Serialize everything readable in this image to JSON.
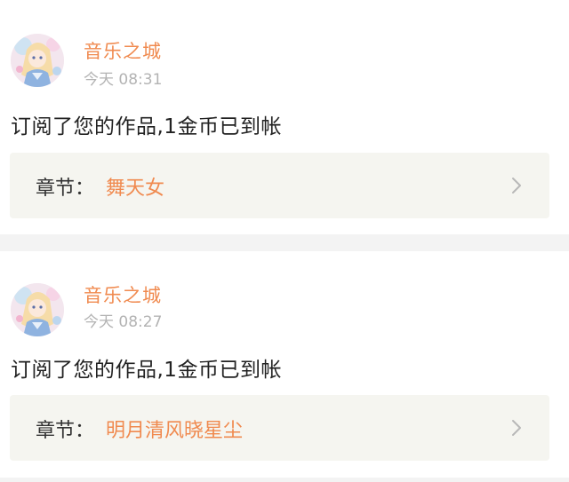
{
  "notifications": [
    {
      "user": "音乐之城",
      "time": "今天 08:31",
      "message": "订阅了您的作品,1金币已到帐",
      "chapter_label": "章节：",
      "chapter_title": "舞天女"
    },
    {
      "user": "音乐之城",
      "time": "今天 08:27",
      "message": "订阅了您的作品,1金币已到帐",
      "chapter_label": "章节：",
      "chapter_title": "明月清风晓星尘"
    }
  ],
  "colors": {
    "accent": "#f08a4f",
    "muted": "#b3b3b3",
    "text": "#222222",
    "panel": "#f5f5f0",
    "divider": "#f3f3f3"
  },
  "icons": {
    "avatar": "avatar-anime-girl",
    "chevron": "chevron-right-icon"
  }
}
